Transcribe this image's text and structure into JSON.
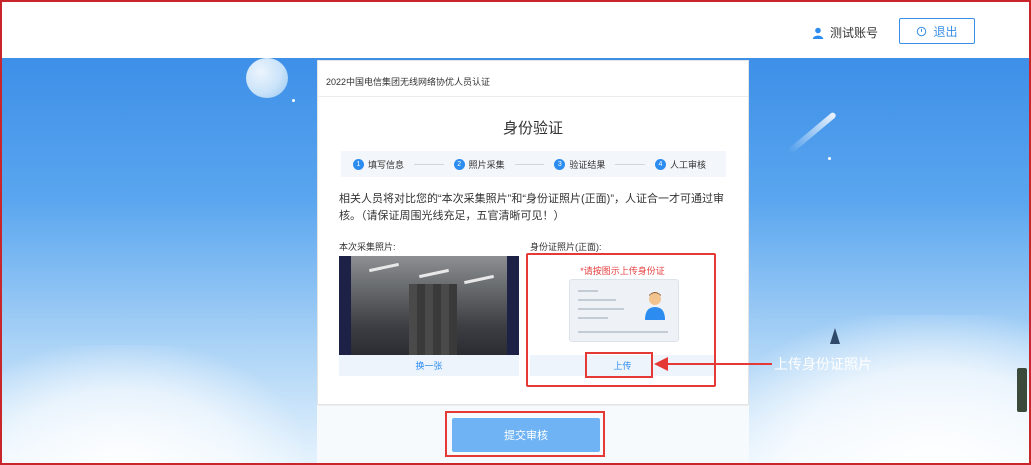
{
  "header": {
    "username": "测试账号",
    "logout_label": "退出",
    "user_icon": "user-icon",
    "logout_icon": "power-icon"
  },
  "card": {
    "breadcrumb": "2022中国电信集团无线网络协优人员认证",
    "title": "身份验证",
    "steps": [
      {
        "num": "1",
        "label": "填写信息"
      },
      {
        "num": "2",
        "label": "照片采集"
      },
      {
        "num": "3",
        "label": "验证结果"
      },
      {
        "num": "4",
        "label": "人工审核"
      }
    ],
    "description": "相关人员将对比您的“本次采集照片”和“身份证照片(正面)”，人证合一才可通过审核。（请保证周围光线充足，五官清晰可见！）",
    "capture_label": "本次采集照片:",
    "id_label": "身份证照片(正面):",
    "swap_button": "换一张",
    "id_hint": "*请按图示上传身份证",
    "upload_button": "上传",
    "submit_button": "提交审核"
  },
  "annotation": {
    "upload_note": "上传身份证照片"
  },
  "colors": {
    "accent": "#2d8cf0",
    "annotation_red": "#e53935",
    "sky_top": "#3d8fe8"
  }
}
